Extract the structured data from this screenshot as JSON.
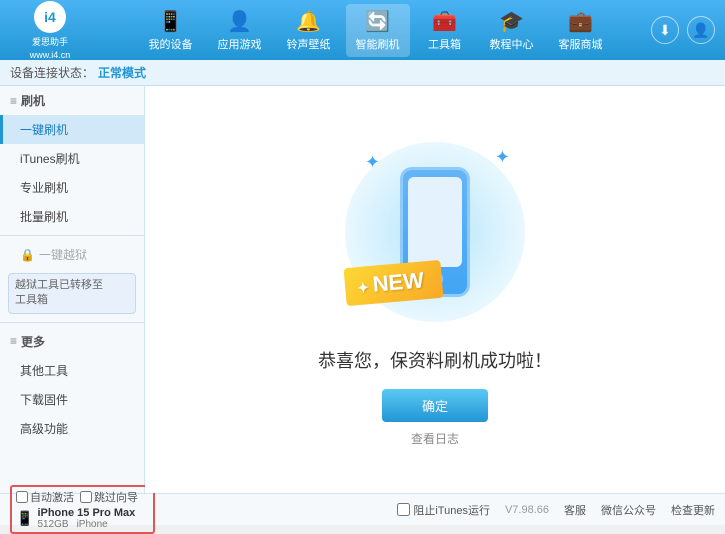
{
  "app": {
    "logo_text": "爱思助手",
    "logo_subtitle": "www.i4.cn",
    "logo_icon": "i4"
  },
  "nav": {
    "items": [
      {
        "id": "my-device",
        "label": "我的设备",
        "icon": "📱"
      },
      {
        "id": "apps-games",
        "label": "应用游戏",
        "icon": "👤"
      },
      {
        "id": "ringtones",
        "label": "铃声壁纸",
        "icon": "🔔"
      },
      {
        "id": "smart-flash",
        "label": "智能刷机",
        "icon": "🔄",
        "active": true
      },
      {
        "id": "toolbox",
        "label": "工具箱",
        "icon": "🧰"
      },
      {
        "id": "tutorials",
        "label": "教程中心",
        "icon": "🎓"
      },
      {
        "id": "service",
        "label": "客服商城",
        "icon": "💼"
      }
    ]
  },
  "subheader": {
    "prefix": "设备连接状态：",
    "mode": "正常模式"
  },
  "sidebar": {
    "flash_section": "刷机",
    "items": [
      {
        "id": "one-click-flash",
        "label": "一键刷机",
        "active": true
      },
      {
        "id": "itunes-flash",
        "label": "iTunes刷机"
      },
      {
        "id": "pro-flash",
        "label": "专业刷机"
      },
      {
        "id": "batch-flash",
        "label": "批量刷机"
      }
    ],
    "disabled_label": "一键越狱",
    "notice": "越狱工具已转移至\n工具箱",
    "more_section": "更多",
    "more_items": [
      {
        "id": "other-tools",
        "label": "其他工具"
      },
      {
        "id": "download-firmware",
        "label": "下载固件"
      },
      {
        "id": "advanced",
        "label": "高级功能"
      }
    ]
  },
  "content": {
    "new_badge": "NEW",
    "success_message": "恭喜您，保资料刷机成功啦！",
    "confirm_button": "确定",
    "log_link": "查看日志"
  },
  "bottom": {
    "auto_activate": "自动激活",
    "guide_export": "跳过向导",
    "device_name": "iPhone 15 Pro Max",
    "device_storage": "512GB",
    "device_type": "iPhone",
    "stop_itunes": "阻止iTunes运行",
    "version": "V7.98.66",
    "feedback": "客服",
    "wechat": "微信公众号",
    "check_update": "检查更新"
  }
}
